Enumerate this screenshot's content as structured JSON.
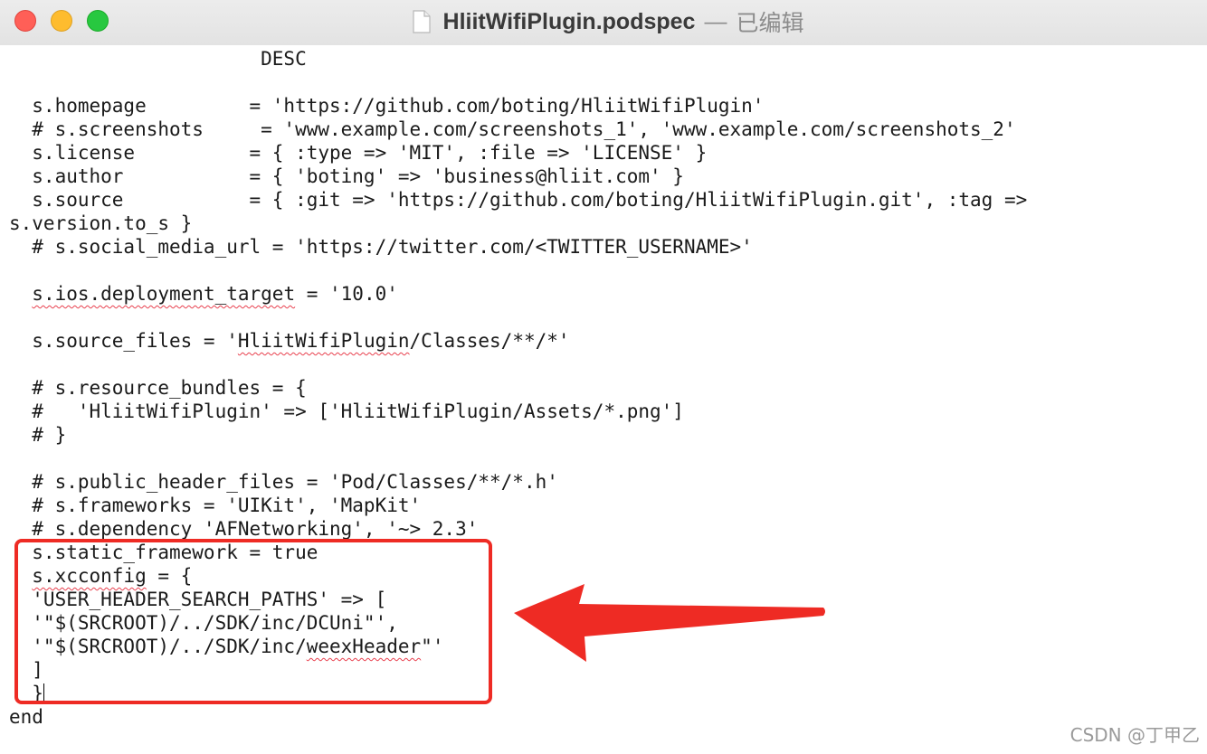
{
  "window": {
    "filename": "HliitWifiPlugin.podspec",
    "separator": "—",
    "status": "已编辑"
  },
  "code_lines": [
    {
      "text": "                      DESC"
    },
    {
      "text": ""
    },
    {
      "text": "  s.homepage         = 'https://github.com/boting/HliitWifiPlugin'"
    },
    {
      "text": "  # s.screenshots     = 'www.example.com/screenshots_1', 'www.example.com/screenshots_2'"
    },
    {
      "text": "  s.license          = { :type => 'MIT', :file => 'LICENSE' }"
    },
    {
      "text": "  s.author           = { 'boting' => 'business@hliit.com' }"
    },
    {
      "text": "  s.source           = { :git => 'https://github.com/boting/HliitWifiPlugin.git', :tag =>"
    },
    {
      "text": "s.version.to_s }"
    },
    {
      "text": "  # s.social_media_url = 'https://twitter.com/<TWITTER_USERNAME>'"
    },
    {
      "text": ""
    },
    {
      "pre": "  ",
      "err": "s.ios.deployment_target",
      "post": " = '10.0'"
    },
    {
      "text": ""
    },
    {
      "pre": "  s.source_files = '",
      "err": "HliitWifiPlugin",
      "post": "/Classes/**/*'"
    },
    {
      "text": ""
    },
    {
      "text": "  # s.resource_bundles = {"
    },
    {
      "text": "  #   'HliitWifiPlugin' => ['HliitWifiPlugin/Assets/*.png']"
    },
    {
      "text": "  # }"
    },
    {
      "text": ""
    },
    {
      "text": "  # s.public_header_files = 'Pod/Classes/**/*.h'"
    },
    {
      "text": "  # s.frameworks = 'UIKit', 'MapKit'"
    },
    {
      "text": "  # s.dependency 'AFNetworking', '~> 2.3'"
    },
    {
      "text": "  s.static_framework = true"
    },
    {
      "pre": "  ",
      "err": "s.xcconfig",
      "post": " = {"
    },
    {
      "text": "  'USER_HEADER_SEARCH_PATHS' => ["
    },
    {
      "text": "  '\"$(SRCROOT)/../SDK/inc/DCUni\"',"
    },
    {
      "pre": "  '\"$(SRCROOT)/../SDK/inc/",
      "err": "weexHeader",
      "post": "\"'"
    },
    {
      "text": "  ]"
    },
    {
      "text": "  }",
      "caret": true
    },
    {
      "text": "end"
    }
  ],
  "watermark": "CSDN @丁甲乙",
  "colors": {
    "annotation_red": "#ee2b24",
    "spellcheck_red": "#e8404e"
  },
  "icons": {
    "document": "doc-icon",
    "annotation_arrow": "arrow-left-icon"
  }
}
